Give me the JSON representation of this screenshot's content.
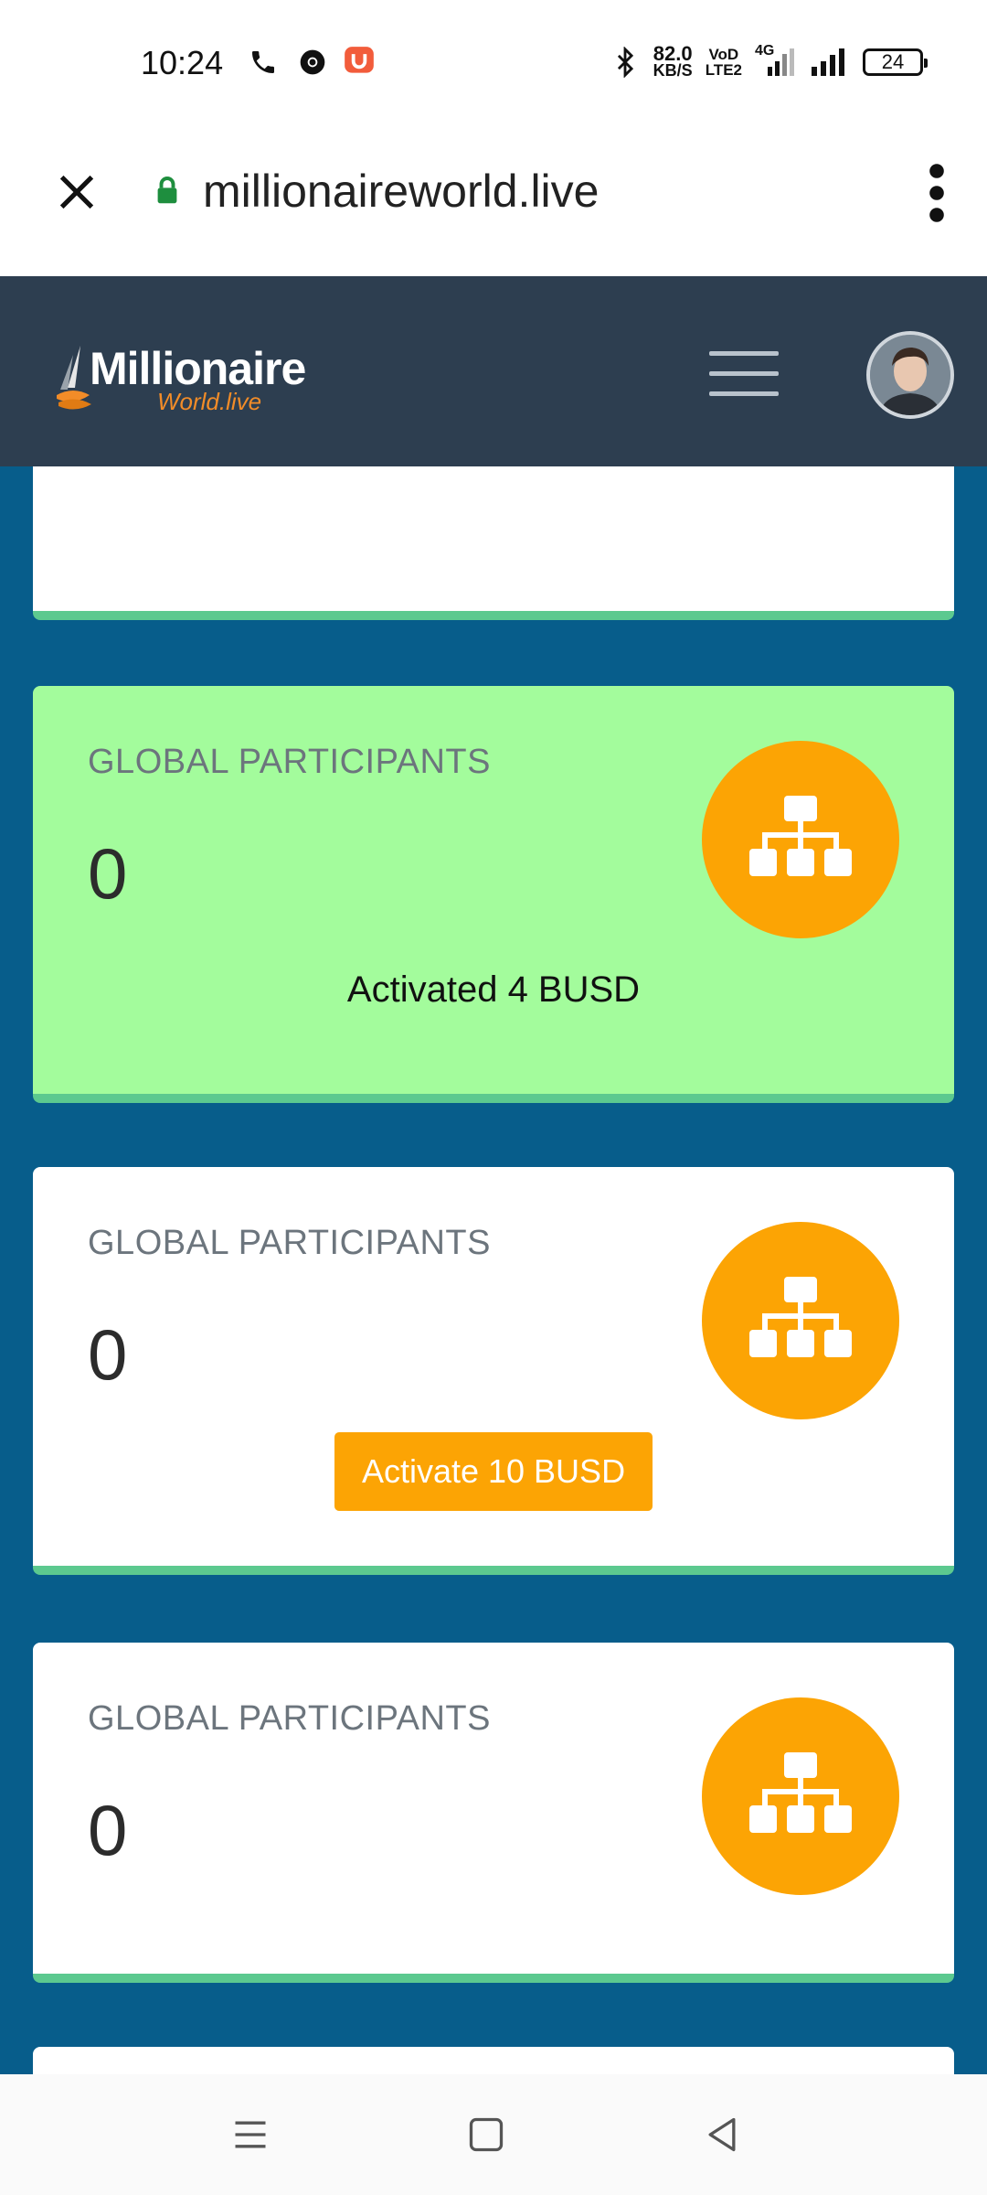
{
  "status_bar": {
    "time": "10:24",
    "net_speed_value": "82.0",
    "net_speed_unit": "KB/S",
    "volte_top": "VoD",
    "volte_bottom": "LTE2",
    "network_type": "4G",
    "battery": "24"
  },
  "browser": {
    "url": "millionaireworld.live"
  },
  "site": {
    "logo_main": "Millionaire",
    "logo_sub": "World.live"
  },
  "cards": [
    {
      "title": "GLOBAL PARTICIPANTS",
      "value": "0",
      "status": "Activated 4 BUSD",
      "background": "#a3fc9c"
    },
    {
      "title": "GLOBAL PARTICIPANTS",
      "value": "0",
      "button": "Activate 10 BUSD"
    },
    {
      "title": "GLOBAL PARTICIPANTS",
      "value": "0"
    }
  ],
  "colors": {
    "header": "#2d3e50",
    "page_background": "#075d8b",
    "card_accent": "#5cc98f",
    "icon_circle": "#fca404",
    "logo_orange": "#f28c28"
  },
  "icons": {
    "close": "close-icon",
    "lock": "lock-icon",
    "menu": "more-vert-icon",
    "hamburger": "hamburger-icon",
    "hierarchy": "sitemap-icon",
    "nav_recent": "recents-icon",
    "nav_home": "home-icon",
    "nav_back": "back-icon"
  }
}
